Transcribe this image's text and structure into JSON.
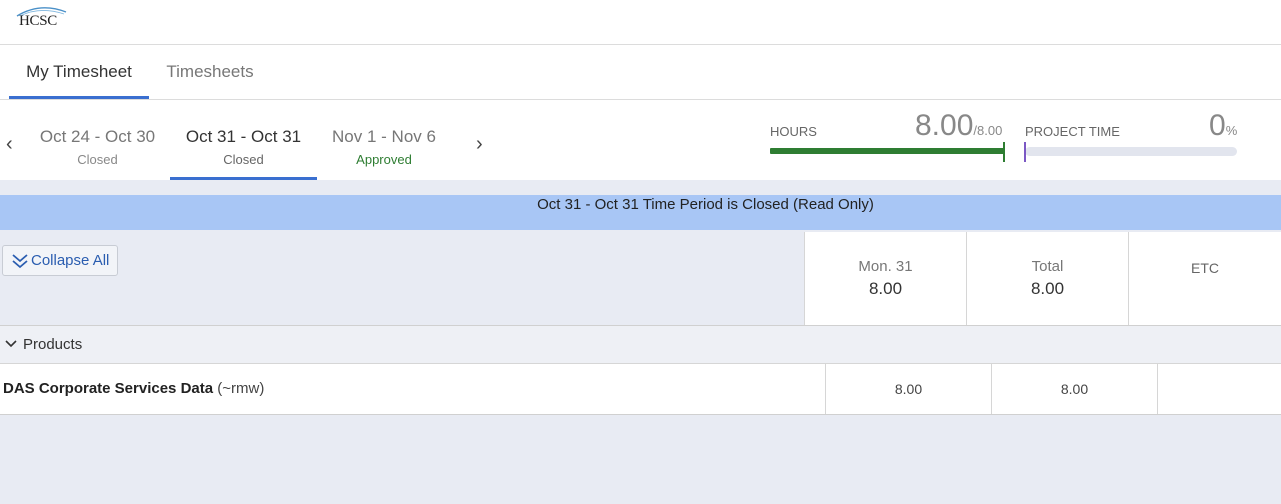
{
  "logo": {
    "text": "HCSC"
  },
  "tabs": [
    {
      "label": "My Timesheet",
      "active": true
    },
    {
      "label": "Timesheets",
      "active": false
    }
  ],
  "periods": [
    {
      "range": "Oct 24 - Oct 30",
      "status": "Closed"
    },
    {
      "range": "Oct 31 - Oct 31",
      "status": "Closed"
    },
    {
      "range": "Nov 1 - Nov 6",
      "status": "Approved"
    }
  ],
  "nav": {
    "prev_icon": "chevron-left-icon",
    "next_icon": "chevron-right-icon"
  },
  "hours": {
    "label": "HOURS",
    "value": "8.00",
    "total": "/8.00",
    "progress": 1.0
  },
  "project_time": {
    "label": "PROJECT TIME",
    "value": "0",
    "unit": "%",
    "progress": 0.0
  },
  "banner": {
    "text": "Oct 31 - Oct 31 Time Period is Closed (Read Only)"
  },
  "toolbar": {
    "collapse_label": "Collapse All"
  },
  "columns": [
    {
      "label": "Mon. 31",
      "value": "8.00"
    },
    {
      "label": "Total",
      "value": "8.00"
    },
    {
      "label": "ETC",
      "value": ""
    }
  ],
  "group": {
    "label": "Products"
  },
  "rows": [
    {
      "name": "DAS Corporate Services Data",
      "code": "(~rmw)",
      "mon": "8.00",
      "total": "8.00",
      "etc": ""
    }
  ],
  "colors": {
    "accent": "#3a6fd0",
    "banner": "#a8c6f5",
    "approved": "#2e7d32",
    "hours_bar": "#2e7d32"
  }
}
